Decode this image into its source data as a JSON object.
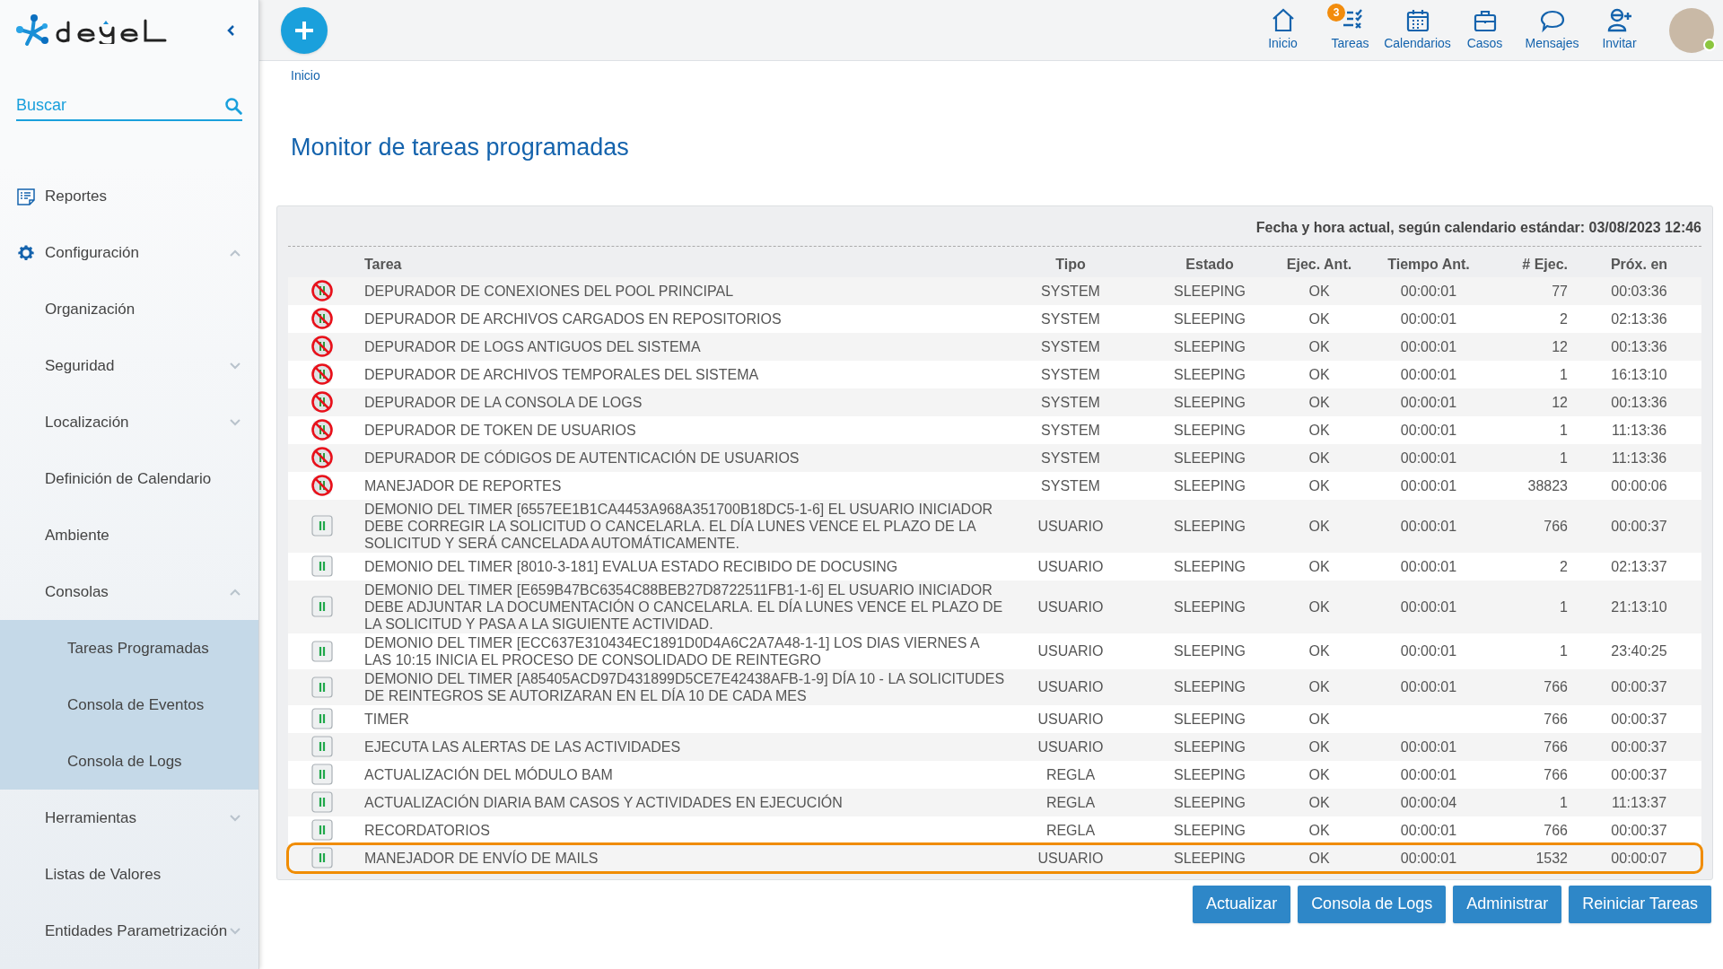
{
  "sidebar": {
    "search": {
      "placeholder": "Buscar"
    },
    "items": [
      {
        "label": "Reportes"
      },
      {
        "label": "Configuración",
        "expanded": true,
        "children": [
          {
            "label": "Organización"
          },
          {
            "label": "Seguridad",
            "expanded": false
          },
          {
            "label": "Localización",
            "expanded": false
          },
          {
            "label": "Definición de Calendario"
          },
          {
            "label": "Ambiente"
          },
          {
            "label": "Consolas",
            "expanded": true,
            "children": [
              {
                "label": "Tareas Programadas"
              },
              {
                "label": "Consola de Eventos"
              },
              {
                "label": "Consola de Logs"
              }
            ]
          },
          {
            "label": "Herramientas",
            "expanded": false
          },
          {
            "label": "Listas de Valores"
          },
          {
            "label": "Entidades Parametrización",
            "expanded": false
          }
        ]
      }
    ]
  },
  "topbar": {
    "nav": [
      {
        "label": "Inicio"
      },
      {
        "label": "Tareas",
        "badge": "3"
      },
      {
        "label": "Calendarios"
      },
      {
        "label": "Casos"
      },
      {
        "label": "Mensajes"
      },
      {
        "label": "Invitar"
      }
    ],
    "user": {
      "online": true
    }
  },
  "breadcrumb": [
    "Inicio"
  ],
  "title": "Monitor de tareas programadas",
  "panel": {
    "datetime": "Fecha y hora actual, según calendario estándar: 03/08/2023 12:46",
    "table": {
      "columns": [
        "Tarea",
        "Tipo",
        "Estado",
        "Ejec. Ant.",
        "Tiempo Ant.",
        "# Ejec.",
        "Próx. en"
      ],
      "rows": [
        {
          "kind": "blocked",
          "highlighted": false,
          "cells": [
            "DEPURADOR DE CONEXIONES DEL POOL PRINCIPAL",
            "SYSTEM",
            "SLEEPING",
            "OK",
            "00:00:01",
            "77",
            "00:03:36"
          ]
        },
        {
          "kind": "blocked",
          "highlighted": false,
          "cells": [
            "DEPURADOR DE ARCHIVOS CARGADOS EN REPOSITORIOS",
            "SYSTEM",
            "SLEEPING",
            "OK",
            "00:00:01",
            "2",
            "02:13:36"
          ]
        },
        {
          "kind": "blocked",
          "highlighted": false,
          "cells": [
            "DEPURADOR DE LOGS ANTIGUOS DEL SISTEMA",
            "SYSTEM",
            "SLEEPING",
            "OK",
            "00:00:01",
            "12",
            "00:13:36"
          ]
        },
        {
          "kind": "blocked",
          "highlighted": false,
          "cells": [
            "DEPURADOR DE ARCHIVOS TEMPORALES DEL SISTEMA",
            "SYSTEM",
            "SLEEPING",
            "OK",
            "00:00:01",
            "1",
            "16:13:10"
          ]
        },
        {
          "kind": "blocked",
          "highlighted": false,
          "cells": [
            "DEPURADOR DE LA CONSOLA DE LOGS",
            "SYSTEM",
            "SLEEPING",
            "OK",
            "00:00:01",
            "12",
            "00:13:36"
          ]
        },
        {
          "kind": "blocked",
          "highlighted": false,
          "cells": [
            "DEPURADOR DE TOKEN DE USUARIOS",
            "SYSTEM",
            "SLEEPING",
            "OK",
            "00:00:01",
            "1",
            "11:13:36"
          ]
        },
        {
          "kind": "blocked",
          "highlighted": false,
          "cells": [
            "DEPURADOR DE CÓDIGOS DE AUTENTICACIÓN DE USUARIOS",
            "SYSTEM",
            "SLEEPING",
            "OK",
            "00:00:01",
            "1",
            "11:13:36"
          ]
        },
        {
          "kind": "blocked",
          "highlighted": false,
          "cells": [
            "MANEJADOR DE REPORTES",
            "SYSTEM",
            "SLEEPING",
            "OK",
            "00:00:01",
            "38823",
            "00:00:06"
          ]
        },
        {
          "kind": "paused",
          "highlighted": false,
          "cells": [
            "DEMONIO DEL TIMER [6557EE1B1CA4453A968A351700B18DC5-1-6] EL USUARIO INICIADOR DEBE CORREGIR LA SOLICITUD O CANCELARLA. EL DÍA LUNES VENCE EL PLAZO DE LA SOLICITUD Y SERÁ CANCELADA AUTOMÁTICAMENTE.",
            "USUARIO",
            "SLEEPING",
            "OK",
            "00:00:01",
            "766",
            "00:00:37"
          ]
        },
        {
          "kind": "paused",
          "highlighted": false,
          "cells": [
            "DEMONIO DEL TIMER [8010-3-181] EVALUA ESTADO RECIBIDO DE DOCUSING",
            "USUARIO",
            "SLEEPING",
            "OK",
            "00:00:01",
            "2",
            "02:13:37"
          ]
        },
        {
          "kind": "paused",
          "highlighted": false,
          "cells": [
            "DEMONIO DEL TIMER [E659B47BC6354C88BEB27D8722511FB1-1-6] EL USUARIO INICIADOR DEBE ADJUNTAR LA DOCUMENTACIÓN O CANCELARLA. EL DÍA LUNES VENCE EL PLAZO DE LA SOLICITUD Y PASA A LA SIGUIENTE ACTIVIDAD.",
            "USUARIO",
            "SLEEPING",
            "OK",
            "00:00:01",
            "1",
            "21:13:10"
          ]
        },
        {
          "kind": "paused",
          "highlighted": false,
          "cells": [
            "DEMONIO DEL TIMER [ECC637E310434EC1891D0D4A6C2A7A48-1-1] LOS DIAS VIERNES A LAS 10:15 INICIA EL PROCESO DE CONSOLIDADO DE REINTEGRO",
            "USUARIO",
            "SLEEPING",
            "OK",
            "00:00:01",
            "1",
            "23:40:25"
          ]
        },
        {
          "kind": "paused",
          "highlighted": false,
          "cells": [
            "DEMONIO DEL TIMER [A85405ACD97D431899D5CE7E42438AFB-1-9] DÍA 10 - LA SOLICITUDES DE REINTEGROS SE AUTORIZARAN EN EL DÍA 10 DE CADA MES",
            "USUARIO",
            "SLEEPING",
            "OK",
            "00:00:01",
            "766",
            "00:00:37"
          ]
        },
        {
          "kind": "paused",
          "highlighted": false,
          "cells": [
            "TIMER",
            "USUARIO",
            "SLEEPING",
            "OK",
            "",
            "766",
            "00:00:37"
          ]
        },
        {
          "kind": "paused",
          "highlighted": false,
          "cells": [
            "EJECUTA LAS ALERTAS DE LAS ACTIVIDADES",
            "USUARIO",
            "SLEEPING",
            "OK",
            "00:00:01",
            "766",
            "00:00:37"
          ]
        },
        {
          "kind": "paused",
          "highlighted": false,
          "cells": [
            "ACTUALIZACIÓN DEL MÓDULO BAM",
            "REGLA",
            "SLEEPING",
            "OK",
            "00:00:01",
            "766",
            "00:00:37"
          ]
        },
        {
          "kind": "paused",
          "highlighted": false,
          "cells": [
            "ACTUALIZACIÓN DIARIA BAM CASOS Y ACTIVIDADES EN EJECUCIÓN",
            "REGLA",
            "SLEEPING",
            "OK",
            "00:00:04",
            "1",
            "11:13:37"
          ]
        },
        {
          "kind": "paused",
          "highlighted": false,
          "cells": [
            "RECORDATORIOS",
            "REGLA",
            "SLEEPING",
            "OK",
            "00:00:01",
            "766",
            "00:00:37"
          ]
        },
        {
          "kind": "paused",
          "highlighted": true,
          "cells": [
            "MANEJADOR DE ENVÍO DE MAILS",
            "USUARIO",
            "SLEEPING",
            "OK",
            "00:00:01",
            "1532",
            "00:00:07"
          ]
        }
      ]
    }
  },
  "buttons": [
    "Actualizar",
    "Consola de Logs",
    "Administrar",
    "Reiniciar Tareas"
  ]
}
